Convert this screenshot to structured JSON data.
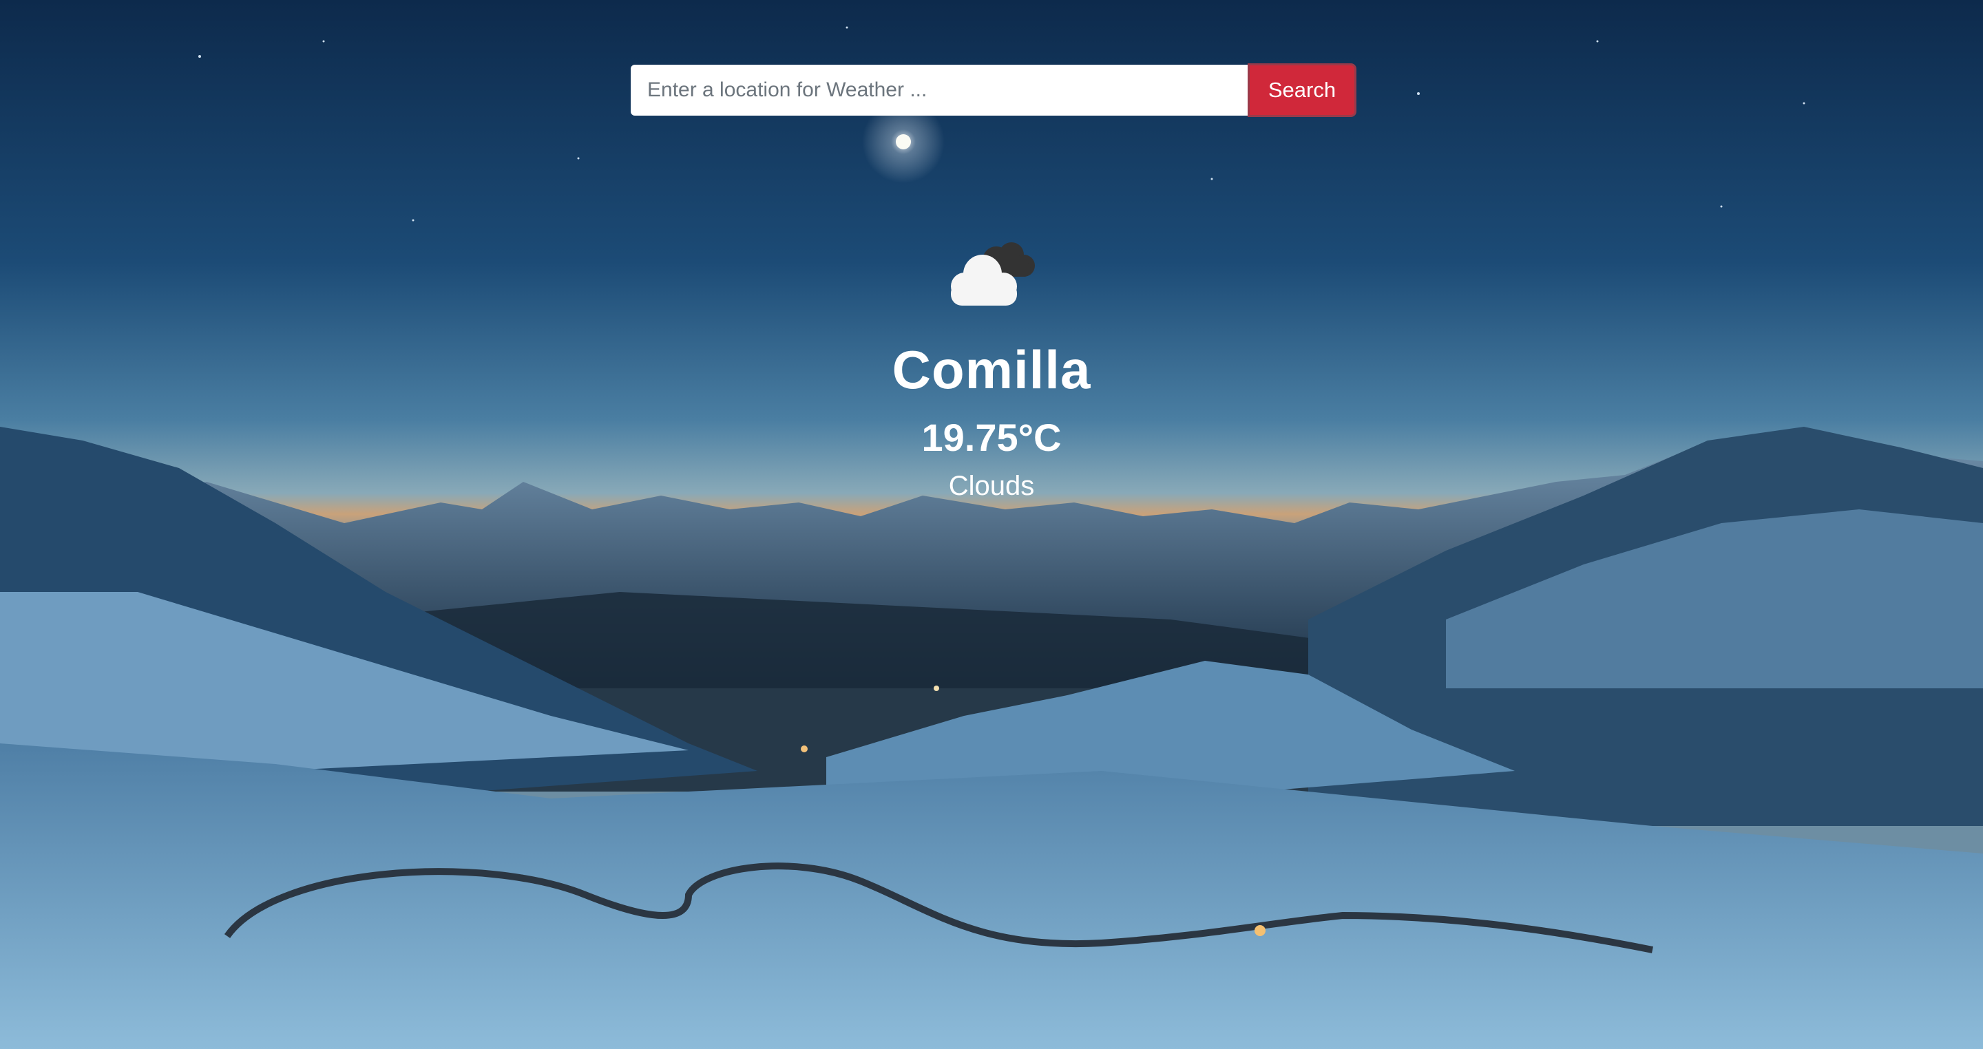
{
  "search": {
    "placeholder": "Enter a location for Weather ...",
    "value": "",
    "button_label": "Search"
  },
  "weather": {
    "icon": "clouds-icon",
    "city": "Comilla",
    "temperature": "19.75°C",
    "description": "Clouds"
  },
  "colors": {
    "button": "#d0283a",
    "text": "#ffffff"
  }
}
